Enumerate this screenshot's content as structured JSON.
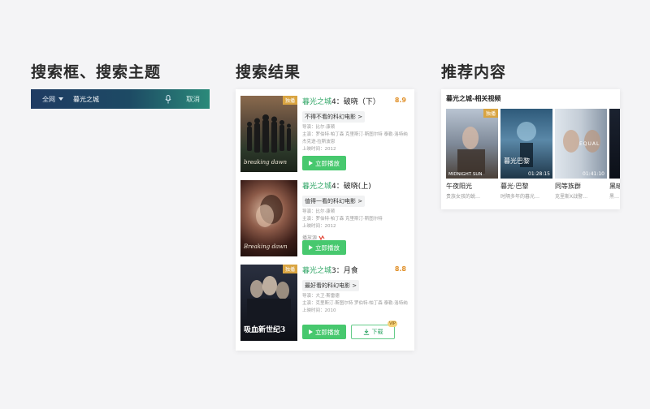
{
  "sections": {
    "search_title": "搜索框、搜索主题",
    "results_title": "搜索结果",
    "recommend_title": "推荐内容"
  },
  "search": {
    "scope": "全网",
    "query": "暮光之城",
    "cancel": "取消",
    "colors": {
      "start": "#1f3b63",
      "end": "#2b8a7a"
    }
  },
  "results": [
    {
      "title_hl": "暮光之城",
      "title_rest": "4：破晓（下）",
      "score": "8.9",
      "tag": "不得不看的科幻电影 >",
      "director": "导演：比尔·康顿",
      "cast": "主演：罗伯特·帕丁森  克里斯汀·斯图尔特  泰勒·洛特纳  杰克逊·拉斯波恩",
      "year": "上映时间：2012",
      "poster_badge": "独播",
      "poster_caption": "breaking dawn",
      "play_label": "立即播放"
    },
    {
      "title_hl": "暮光之城",
      "title_rest": "4：破晓(上)",
      "score": "",
      "tag": "值得一看的科幻电影 >",
      "director": "导演：比尔·康顿",
      "cast": "主演：罗伯特·帕丁森  克里斯汀·斯图尔特",
      "year": "上映时间：2012",
      "source": "播放源",
      "poster_badge": "",
      "poster_caption": "Breaking dawn",
      "play_label": "立即播放"
    },
    {
      "title_hl": "暮光之城",
      "title_rest": "3：月食",
      "score": "8.8",
      "tag": "最好看的科幻电影 >",
      "director": "导演：大卫·斯雷德",
      "cast": "主演：克里斯汀·斯图尔特  罗伯特·帕丁森  泰勒·洛特纳",
      "year": "上映时间：2010",
      "poster_badge": "独播",
      "poster_caption": "吸血新世纪3",
      "play_label": "立即播放",
      "download_label": "下载",
      "vip_label": "VIP"
    }
  ],
  "recommend": {
    "heading": "暮光之城-相关视频",
    "items": [
      {
        "title": "午夜阳光",
        "sub": "贵族女孩的蜕…",
        "duration": "",
        "badge": "独播",
        "caption": "MIDNIGHT SUN"
      },
      {
        "title": "暮光·巴黎",
        "sub": "时隔多年的暮光…",
        "duration": "01:28:15",
        "badge": "",
        "caption": "暮光巴黎"
      },
      {
        "title": "同等族群",
        "sub": "克里斯X战警…",
        "duration": "01:41:10",
        "badge": "",
        "caption": "EQUAL"
      },
      {
        "title": "黑暗",
        "sub": "黑…",
        "duration": "",
        "badge": "",
        "caption": ""
      }
    ]
  }
}
